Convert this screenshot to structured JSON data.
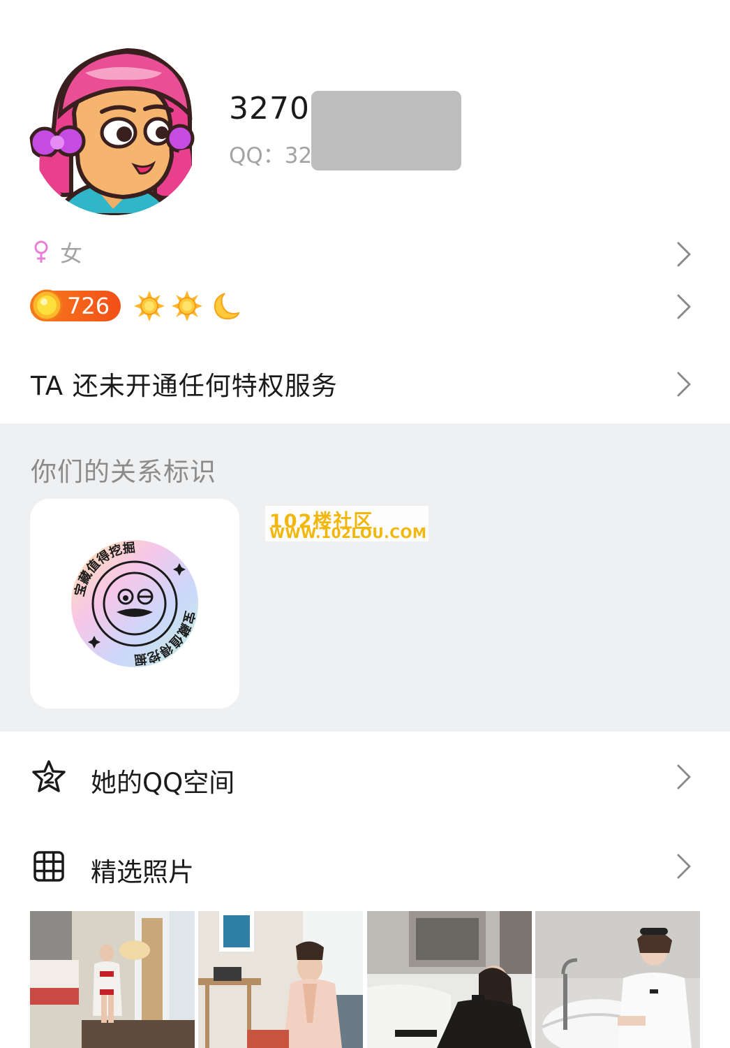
{
  "profile": {
    "nickname": "32707",
    "qq_label": "QQ：32",
    "gender_symbol": "♀",
    "gender": "女",
    "level_value": "726",
    "level_icons": [
      "sun-icon",
      "sun-icon",
      "moon-icon"
    ],
    "privilege_text": "TA 还未开通任何特权服务"
  },
  "relation": {
    "title": "你们的关系标识",
    "badge_text": "宝藏值得挖掘"
  },
  "watermark": {
    "line1": "102楼社区",
    "line2": "WWW.102LOU.COM"
  },
  "menu": {
    "qzone_label": "她的QQ空间",
    "photos_label": "精选照片"
  },
  "colors": {
    "accent_orange": "#f24f18",
    "section_bg": "#eff0f2",
    "muted_text": "#a3a3a3",
    "gender_pink": "#e77fd6"
  }
}
